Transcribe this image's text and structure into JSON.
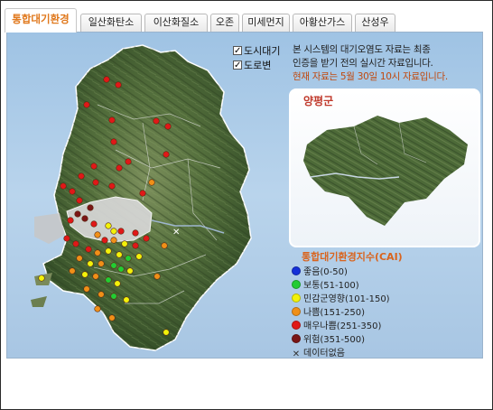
{
  "tabs": [
    {
      "label": "통합대기환경",
      "active": true
    },
    {
      "label": "일산화탄소"
    },
    {
      "label": "이산화질소"
    },
    {
      "label": "오존"
    },
    {
      "label": "미세먼지"
    },
    {
      "label": "아황산가스"
    },
    {
      "label": "산성우"
    }
  ],
  "layers": {
    "city_air": "도시대기",
    "roadside": "도로변"
  },
  "info": {
    "line1": "본 시스템의 대기오염도 자료는 최종",
    "line2": "인증을 받기 전의 실시간 자료입니다.",
    "line3_prefix": "현재 자료는",
    "month": "5",
    "month_unit": "월",
    "day": "30",
    "day_unit": "일",
    "hour": "10",
    "line3_suffix": "시 자료입니다."
  },
  "detail": {
    "region": "양평군"
  },
  "legend": {
    "title": "통합대기환경지수(CAI)",
    "items": [
      {
        "label": "좋음(0-50)",
        "color": "#1530d8"
      },
      {
        "label": "보통(51-100)",
        "color": "#22cc33"
      },
      {
        "label": "민감군영향(101-150)",
        "color": "#f2f20a"
      },
      {
        "label": "나쁨(151-250)",
        "color": "#f09018"
      },
      {
        "label": "매우나쁨(251-350)",
        "color": "#e01818"
      },
      {
        "label": "위험(351-500)",
        "color": "#7a1616"
      },
      {
        "label": "데이터없음",
        "icon": "x-icon"
      }
    ]
  },
  "map": {
    "stations": [
      {
        "name": "station",
        "status": "red"
      }
    ]
  }
}
